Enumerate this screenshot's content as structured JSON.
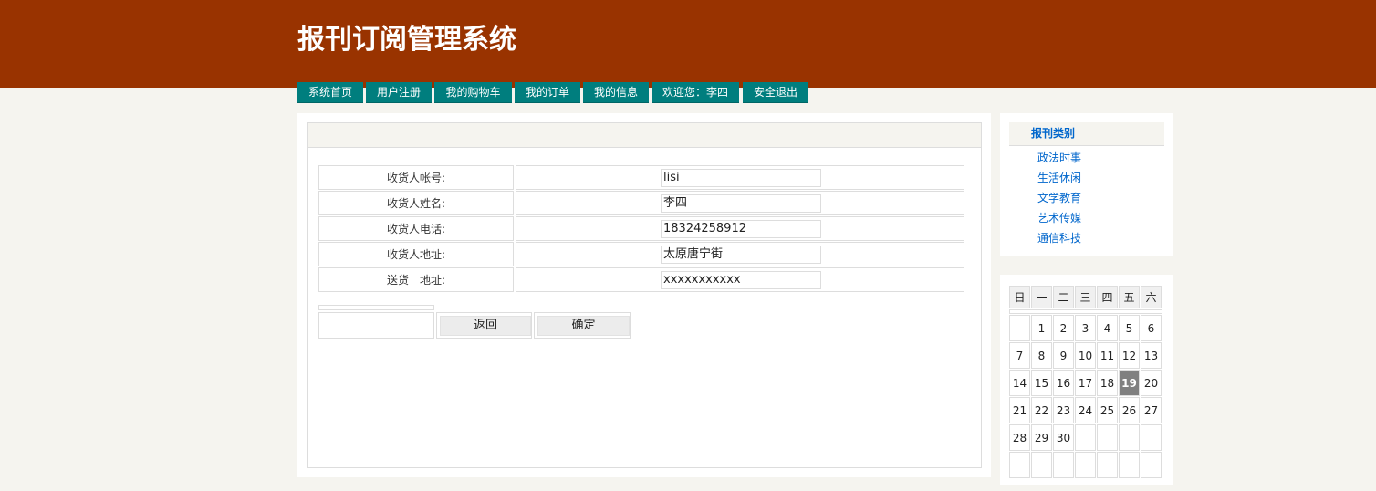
{
  "header": {
    "title": "报刊订阅管理系统",
    "bg_color": "#993300"
  },
  "nav": {
    "accent_color": "#007e7e",
    "items": [
      "系统首页",
      "用户注册",
      "我的购物车",
      "我的订单",
      "我的信息",
      "欢迎您：李四",
      "安全退出"
    ]
  },
  "form": {
    "rows": [
      {
        "label": "收货人帐号:",
        "value": "lisi"
      },
      {
        "label": "收货人姓名:",
        "value": "李四"
      },
      {
        "label": "收货人电话:",
        "value": "18324258912"
      },
      {
        "label": "收货人地址:",
        "value": "太原唐宁街"
      },
      {
        "label": "送货　地址:",
        "value": "xxxxxxxxxxx"
      }
    ],
    "back_label": "返回",
    "confirm_label": "确定"
  },
  "sidebar": {
    "title": "报刊类别",
    "items": [
      "政法时事",
      "生活休闲",
      "文学教育",
      "艺术传媒",
      "通信科技"
    ]
  },
  "calendar": {
    "weekdays": [
      "日",
      "一",
      "二",
      "三",
      "四",
      "五",
      "六"
    ],
    "weeks": [
      [
        "",
        "1",
        "2",
        "3",
        "4",
        "5",
        "6"
      ],
      [
        "7",
        "8",
        "9",
        "10",
        "11",
        "12",
        "13"
      ],
      [
        "14",
        "15",
        "16",
        "17",
        "18",
        "19",
        "20"
      ],
      [
        "21",
        "22",
        "23",
        "24",
        "25",
        "26",
        "27"
      ],
      [
        "28",
        "29",
        "30",
        "",
        "",
        "",
        ""
      ],
      [
        "",
        "",
        "",
        "",
        "",
        "",
        ""
      ]
    ],
    "today": "19"
  }
}
